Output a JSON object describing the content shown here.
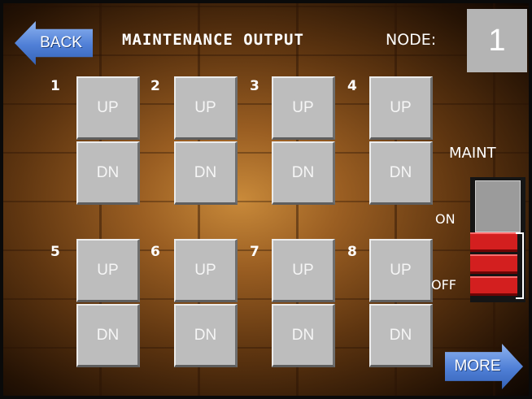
{
  "header": {
    "back_label": "BACK",
    "title": "MAINTENANCE OUTPUT",
    "node_label": "NODE:",
    "node_value": "1"
  },
  "outputs": [
    {
      "number": "1",
      "up_label": "UP",
      "down_label": "DN"
    },
    {
      "number": "2",
      "up_label": "UP",
      "down_label": "DN"
    },
    {
      "number": "3",
      "up_label": "UP",
      "down_label": "DN"
    },
    {
      "number": "4",
      "up_label": "UP",
      "down_label": "DN"
    },
    {
      "number": "5",
      "up_label": "UP",
      "down_label": "DN"
    },
    {
      "number": "6",
      "up_label": "UP",
      "down_label": "DN"
    },
    {
      "number": "7",
      "up_label": "UP",
      "down_label": "DN"
    },
    {
      "number": "8",
      "up_label": "UP",
      "down_label": "DN"
    }
  ],
  "maint_switch": {
    "label": "MAINT",
    "on_label": "ON",
    "off_label": "OFF",
    "state": "OFF"
  },
  "footer": {
    "more_label": "MORE"
  },
  "colors": {
    "button_gray": "#bdbdbd",
    "arrow_blue": "#4f7fd6",
    "switch_red": "#d31f1f",
    "node_box_gray": "#b4b4b4"
  }
}
